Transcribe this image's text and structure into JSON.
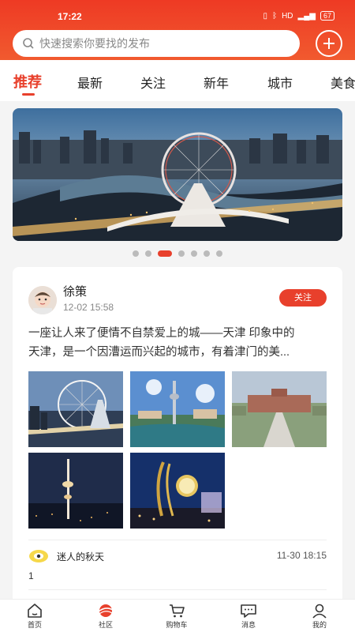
{
  "status": {
    "time": "17:22",
    "battery": "67"
  },
  "search": {
    "placeholder": "快速搜索你要找的发布"
  },
  "tabs": [
    {
      "label": "推荐"
    },
    {
      "label": "最新"
    },
    {
      "label": "关注"
    },
    {
      "label": "新年"
    },
    {
      "label": "城市"
    },
    {
      "label": "美食"
    }
  ],
  "banner": {
    "slide_count": 7,
    "active_index": 2
  },
  "post": {
    "author": "徐策",
    "time": "12-02 15:58",
    "follow_label": "关注",
    "text_line1": "一座让人来了便情不自禁爱上的城——天津 印象中的",
    "text_line2": "天津，是一个因漕运而兴起的城市，有着津门的美...",
    "images": [
      "ferris-wheel-bridge-photo",
      "tv-tower-lake-photo",
      "campus-plaza-photo",
      "night-tower-photo",
      "clock-sculpture-night-photo"
    ],
    "comment": {
      "name": "迷人的秋天",
      "time": "11-30 18:15",
      "text": "1"
    }
  },
  "bottom_nav": [
    {
      "label": "首页",
      "icon": "home-icon"
    },
    {
      "label": "社区",
      "icon": "community-icon"
    },
    {
      "label": "购物车",
      "icon": "cart-icon"
    },
    {
      "label": "消息",
      "icon": "message-icon"
    },
    {
      "label": "我的",
      "icon": "profile-icon"
    }
  ],
  "colors": {
    "accent": "#e8402c"
  }
}
